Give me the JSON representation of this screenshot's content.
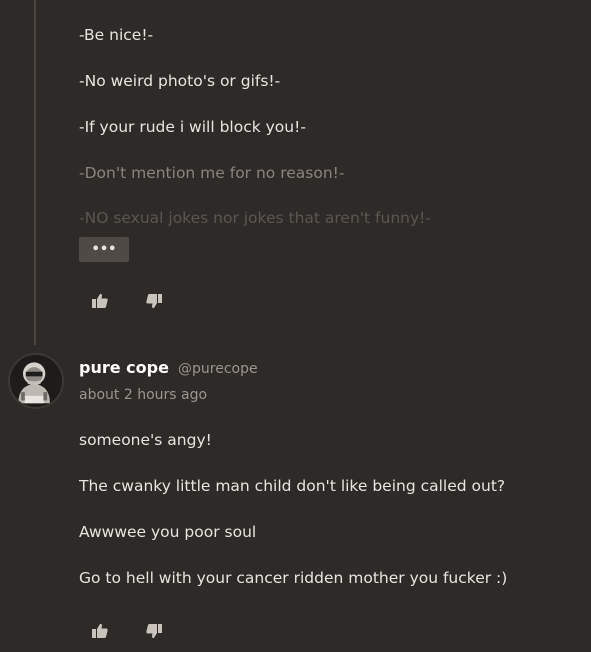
{
  "post1": {
    "rules": [
      "-Be nice!-",
      "-No weird photo's or gifs!-",
      "-If your rude i will block you!-",
      "-Don't mention me for no reason!-",
      "-NO sexual jokes nor jokes that aren't funny!-"
    ],
    "more_label": "•••",
    "actions": {
      "like_icon": "thumbs-up-icon",
      "dislike_icon": "thumbs-down-icon"
    }
  },
  "post2": {
    "author": {
      "name": "pure cope",
      "handle": "@purecope",
      "avatar_icon": "hooded-figure-avatar"
    },
    "timestamp": "about 2 hours ago",
    "lines": [
      "someone's angy!",
      "The cwanky little man child don't like being called out?",
      "Awwwee you poor soul",
      "Go to hell with your cancer ridden mother you fucker :)"
    ],
    "actions": {
      "like_icon": "thumbs-up-icon",
      "dislike_icon": "thumbs-down-icon"
    }
  },
  "colors": {
    "background": "#2e2a27",
    "text": "#e8e4df",
    "muted": "#9b958f",
    "button": "#4f4a46"
  }
}
